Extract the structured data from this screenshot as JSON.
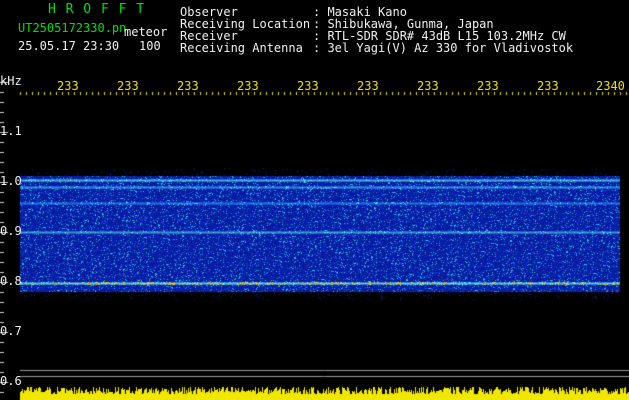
{
  "title_banner": "H R O F F T",
  "file": {
    "name": "UT2505172330.pn",
    "tag": "meteor",
    "datetime": "25.05.17 23:30",
    "count": "100"
  },
  "info": {
    "labels": [
      "Observer",
      "Receiving Location",
      "Receiver",
      "Receiving Antenna"
    ],
    "values": [
      ": Masaki Kano",
      ": Shibukawa, Gunma, Japan",
      ": RTL-SDR SDR# 43dB L15 103.2MHz CW",
      ": 3el Yagi(V) Az 330 for Vladivostok"
    ]
  },
  "y_axis": {
    "unit": "kHz",
    "ticks": [
      "1.1",
      "1.0",
      "0.9",
      "0.8",
      "0.7",
      "0.6"
    ]
  },
  "x_axis": {
    "ticks": [
      "233",
      "233",
      "233",
      "233",
      "233",
      "233",
      "233",
      "233",
      "233",
      "2340"
    ]
  },
  "colors": {
    "banner": "#00e000",
    "text": "#f0f0f0",
    "axis_ticks": "#f0e000",
    "spectrum_bg": "#0a1a9a"
  }
}
